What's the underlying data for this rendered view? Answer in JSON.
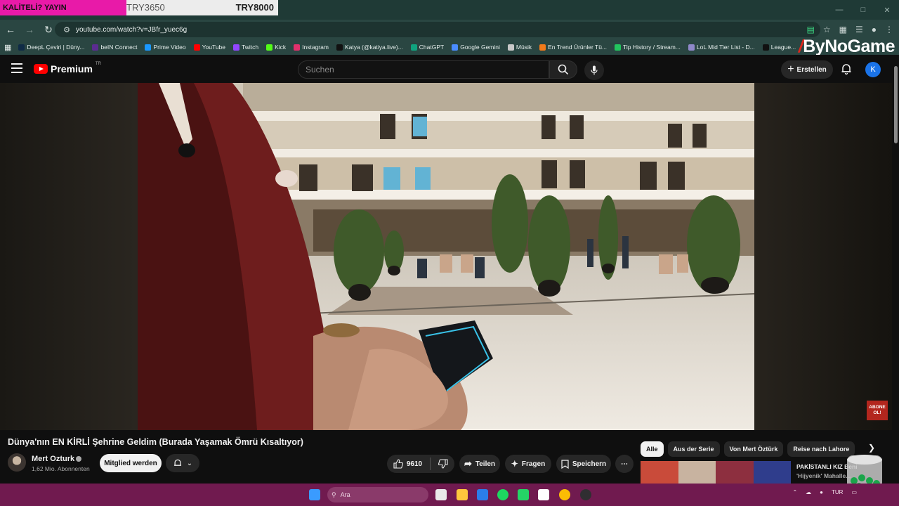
{
  "overlay": {
    "label": "KALİTELİ? YAYIN",
    "price_low": "TRY3650",
    "price_high": "TRY8000"
  },
  "browser": {
    "url": "youtube.com/watch?v=JBfr_yuec6g",
    "bookmarks": [
      {
        "label": "DeepL Çeviri | Düny...",
        "color": "#0f2b46"
      },
      {
        "label": "beIN Connect",
        "color": "#5b2c91"
      },
      {
        "label": "Prime Video",
        "color": "#1a98ff"
      },
      {
        "label": "YouTube",
        "color": "#ff0000"
      },
      {
        "label": "Twitch",
        "color": "#9146ff"
      },
      {
        "label": "Kick",
        "color": "#53fc18"
      },
      {
        "label": "Instagram",
        "color": "#e1306c"
      },
      {
        "label": "Katya (@katiya.live)...",
        "color": "#111111"
      },
      {
        "label": "ChatGPT",
        "color": "#10a37f"
      },
      {
        "label": "Google Gemini",
        "color": "#4a8cff"
      },
      {
        "label": "Müsik",
        "color": "#c8c8c8"
      },
      {
        "label": "En Trend Ürünler Tü...",
        "color": "#f27a1a"
      },
      {
        "label": "Tip History / Stream...",
        "color": "#22c55e"
      },
      {
        "label": "LoL Mid Tier List - D...",
        "color": "#8f88c9"
      },
      {
        "label": "League...",
        "color": "#111111"
      }
    ],
    "watermark_logo": "ByNoGame"
  },
  "youtube": {
    "logo_text": "Premium",
    "region": "TR",
    "search_placeholder": "Suchen",
    "create_label": "Erstellen",
    "avatar_letter": "K",
    "video_title": "Dünya'nın EN KİRLİ Şehrine Geldim (Burada Yaşamak Ömrü Kısaltıyor)",
    "channel_name": "Mert Ozturk",
    "subscribers": "1,62 Mio. Abonnenten",
    "join_label": "Mitglied werden",
    "like_count": "9610",
    "share_label": "Teilen",
    "ask_label": "Fragen",
    "save_label": "Speichern",
    "abone_badge": "ABONE OL!",
    "chips": [
      "Alle",
      "Aus der Serie",
      "Von Mert Öztürk",
      "Reise nach Lahore"
    ],
    "rec_title_line1": "PAKİSTANLI KIZ Beni",
    "rec_title_line2": "'Hijyenik' Mahalle..."
  },
  "taskbar": {
    "search_label": "Ara",
    "language": "TUR",
    "icons": [
      {
        "name": "windows-start-icon",
        "color": "#3a9bff"
      },
      {
        "name": "widgets-icon",
        "color": "#e9e9e9"
      },
      {
        "name": "file-explorer-icon",
        "color": "#ffc83d"
      },
      {
        "name": "store-icon",
        "color": "#2b7de9"
      },
      {
        "name": "spotify-icon",
        "color": "#1ed760"
      },
      {
        "name": "whatsapp-icon",
        "color": "#25d366"
      },
      {
        "name": "app-icon",
        "color": "#ffffff"
      },
      {
        "name": "chrome-icon",
        "color": "#fbbc04"
      },
      {
        "name": "obs-icon",
        "color": "#302e31"
      }
    ]
  }
}
